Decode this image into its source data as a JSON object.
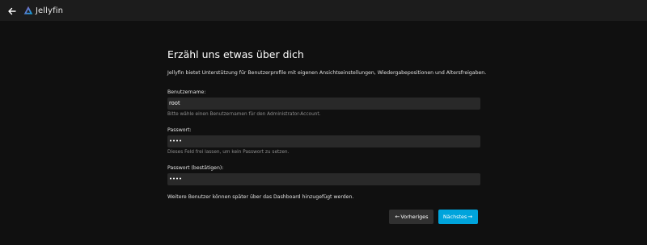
{
  "header": {
    "app_name": "Jellyfin"
  },
  "wizard": {
    "title": "Erzähl uns etwas über dich",
    "intro": "Jellyfin bietet Unterstützung für Benutzerprofile mit eigenen Ansichtseinstellungen, Wiedergabepositionen und Altersfreigaben.",
    "username": {
      "label": "Benutzername:",
      "value": "root",
      "hint": "Bitte wähle einen Benutzernamen für den Administrator-Account."
    },
    "password": {
      "label": "Passwort:",
      "value": "••••",
      "hint": "Dieses Feld frei lassen, um kein Passwort zu setzen."
    },
    "password_confirm": {
      "label": "Passwort (bestätigen):",
      "value": "••••"
    },
    "footer_note": "Weitere Benutzer können später über das Dashboard hinzugefügt werden.",
    "buttons": {
      "previous_arrow": "←",
      "previous": "Vorheriges",
      "next": "Nächstes",
      "next_arrow": "→"
    }
  },
  "colors": {
    "accent": "#00a4dc",
    "background": "#101010",
    "header": "#1c1c1c",
    "input": "#292929"
  }
}
